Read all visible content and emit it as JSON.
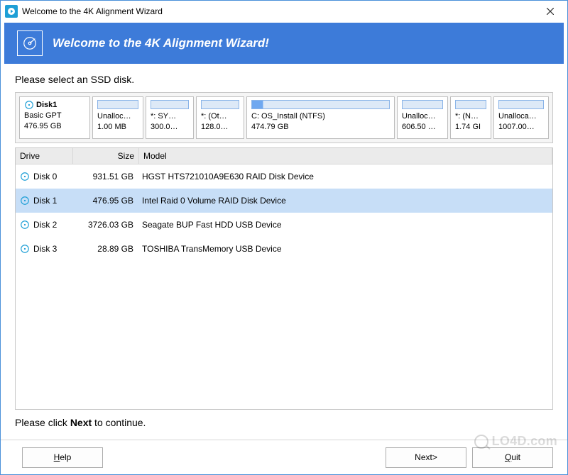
{
  "titlebar": {
    "title": "Welcome to the 4K Alignment Wizard"
  },
  "header": {
    "title": "Welcome to the 4K Alignment Wizard!"
  },
  "instruction": "Please select an SSD disk.",
  "disk_overview": {
    "name": "Disk1",
    "type": "Basic GPT",
    "size": "476.95 GB",
    "partitions": [
      {
        "label": "Unalloc…",
        "sub": "1.00 MB"
      },
      {
        "label": "*: SY…",
        "sub": "300.0…"
      },
      {
        "label": "*: (Ot…",
        "sub": "128.0…"
      },
      {
        "label": "C: OS_Install (NTFS)",
        "sub": "474.79 GB"
      },
      {
        "label": "Unalloc…",
        "sub": "606.50 …"
      },
      {
        "label": "*: (N…",
        "sub": "1.74 GI"
      },
      {
        "label": "Unalloca…",
        "sub": "1007.00…"
      }
    ]
  },
  "grid": {
    "columns": {
      "drive": "Drive",
      "size": "Size",
      "model": "Model"
    },
    "rows": [
      {
        "drive": "Disk 0",
        "size": "931.51 GB",
        "model": "HGST HTS721010A9E630 RAID Disk Device",
        "selected": false
      },
      {
        "drive": "Disk 1",
        "size": "476.95 GB",
        "model": "Intel   Raid 0 Volume RAID Disk Device",
        "selected": true
      },
      {
        "drive": "Disk 2",
        "size": "3726.03 GB",
        "model": "Seagate  BUP Fast HDD     USB Device",
        "selected": false
      },
      {
        "drive": "Disk 3",
        "size": "28.89 GB",
        "model": "TOSHIBA  TransMemory       USB Device",
        "selected": false
      }
    ]
  },
  "hint_prefix": "Please click ",
  "hint_bold": "Next",
  "hint_suffix": " to continue.",
  "buttons": {
    "help": "Help",
    "next": "Next>",
    "quit": "Quit",
    "help_ul": "H",
    "quit_ul": "Q"
  },
  "watermark": "LO4D.com"
}
